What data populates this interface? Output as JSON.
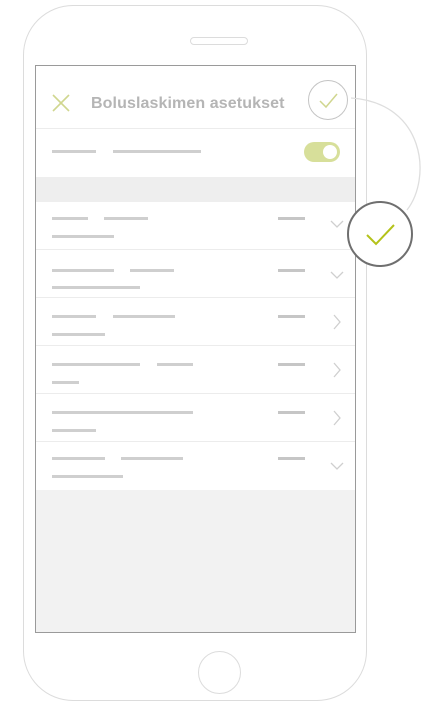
{
  "header": {
    "title": "Boluslaskimen asetukset",
    "close_icon": "close-icon",
    "confirm_icon": "check-icon"
  },
  "settings": {
    "toggle_enabled": true,
    "rows": [
      {
        "trailing_icon": "chevron-down-icon"
      },
      {
        "trailing_icon": "chevron-down-icon"
      },
      {
        "trailing_icon": "chevron-right-icon"
      },
      {
        "trailing_icon": "chevron-right-icon"
      },
      {
        "trailing_icon": "chevron-right-icon"
      },
      {
        "trailing_icon": "chevron-down-icon"
      }
    ]
  },
  "colors": {
    "accent": "#b4c21a",
    "accent_light": "#d7df9a",
    "disabled_text": "#b5b5b5"
  }
}
